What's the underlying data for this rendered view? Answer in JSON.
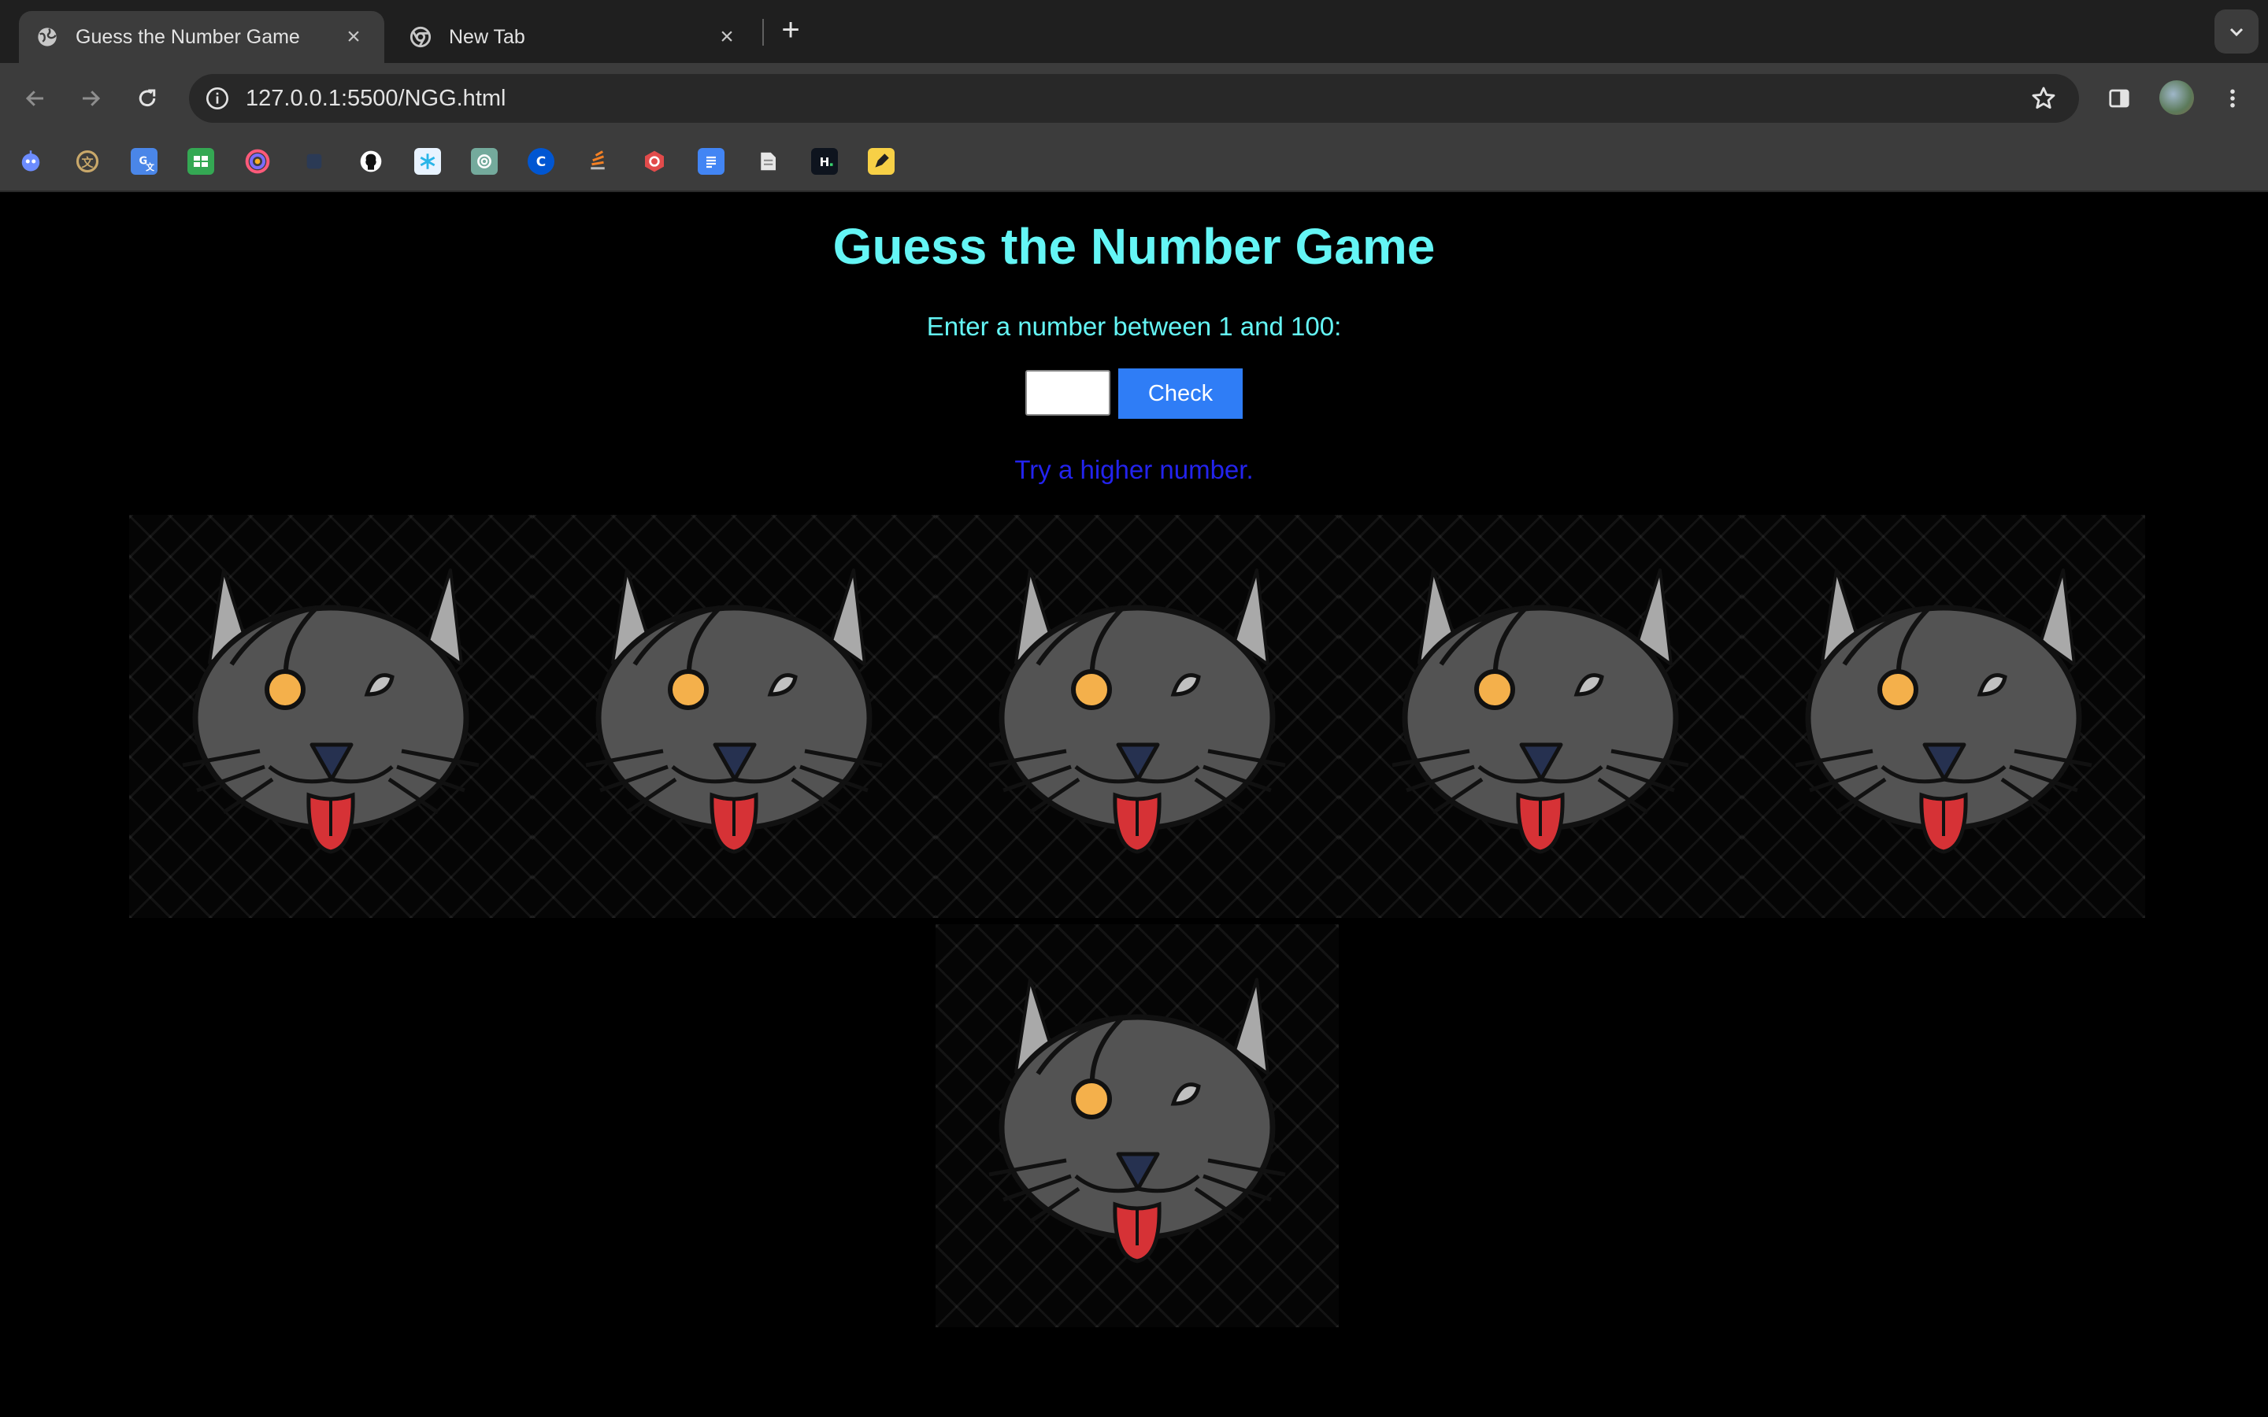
{
  "browser": {
    "tabs": [
      {
        "title": "Guess the Number Game",
        "active": true
      },
      {
        "title": "New Tab",
        "active": false
      }
    ],
    "url": "127.0.0.1:5500/NGG.html",
    "bookmarks": [
      "chatbot-icon",
      "translate-icon",
      "google-translate-icon",
      "sheets-icon",
      "arc-icon",
      "blank-icon",
      "github-icon",
      "snowflake-icon",
      "openai-icon",
      "coursera-icon",
      "stack-icon",
      "codesignal-icon",
      "docs-icon",
      "notes-icon",
      "hackerrank-icon",
      "pencil-icon"
    ]
  },
  "game": {
    "title": "Guess the Number Game",
    "prompt": "Enter a number between 1 and 100:",
    "input_value": "",
    "check_label": "Check",
    "feedback": "Try a higher number.",
    "attempt_images": 6
  },
  "colors": {
    "title": "#64f5f5",
    "feedback": "#2323ee",
    "button": "#2f7df6"
  }
}
